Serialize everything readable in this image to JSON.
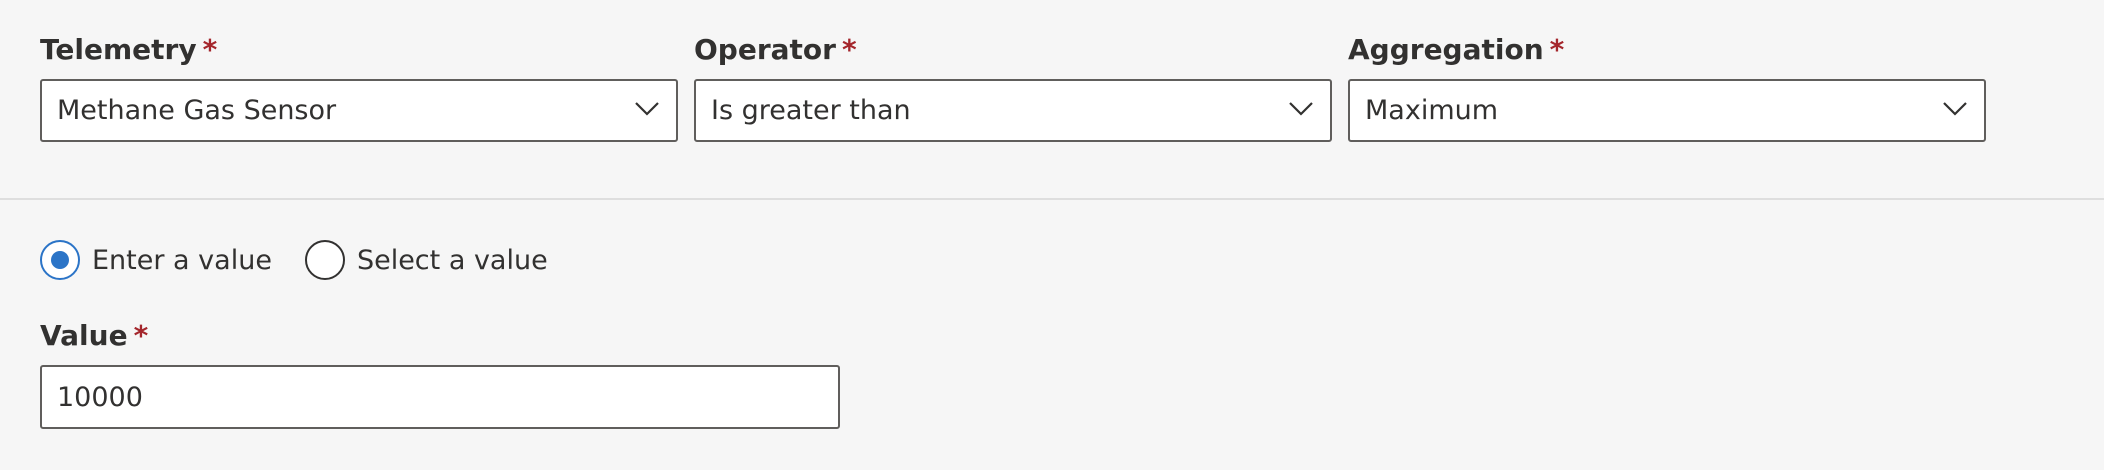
{
  "fields": {
    "telemetry": {
      "label": "Telemetry",
      "required_mark": "*",
      "value": "Methane Gas Sensor",
      "icon": "chevron-down-icon"
    },
    "operator": {
      "label": "Operator",
      "required_mark": "*",
      "value": "Is greater than",
      "icon": "chevron-down-icon"
    },
    "aggregation": {
      "label": "Aggregation",
      "required_mark": "*",
      "value": "Maximum",
      "icon": "chevron-down-icon"
    }
  },
  "value_source": {
    "options": [
      {
        "label": "Enter a value",
        "selected": true
      },
      {
        "label": "Select a value",
        "selected": false
      }
    ]
  },
  "value_field": {
    "label": "Value",
    "required_mark": "*",
    "value": "10000"
  },
  "colors": {
    "background": "#f6f6f6",
    "required": "#a4262c",
    "accent": "#2b74c7",
    "border": "#605e5c",
    "text": "#323130"
  }
}
